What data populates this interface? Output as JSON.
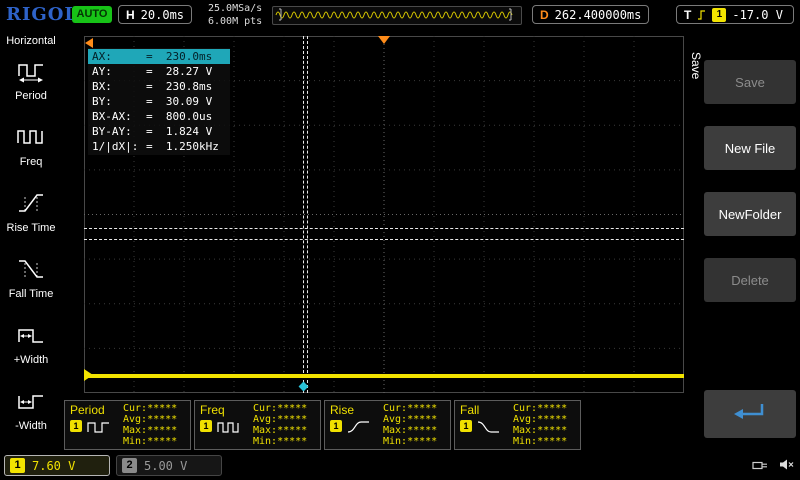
{
  "top_bar": {
    "logo": "RIGOL",
    "status_badge": "AUTO",
    "h_label": "H",
    "timebase": "20.0ms",
    "sample_rate": "25.0MSa/s",
    "memory_depth": "6.00M pts",
    "d_label": "D",
    "delay_value": "262.400000ms",
    "t_label": "T",
    "trigger_channel": "1",
    "trigger_level": "-17.0 V"
  },
  "left_sidebar": {
    "title": "Horizontal",
    "items": [
      {
        "label": "Period",
        "icon": "period-icon"
      },
      {
        "label": "Freq",
        "icon": "freq-icon"
      },
      {
        "label": "Rise Time",
        "icon": "rise-time-icon"
      },
      {
        "label": "Fall Time",
        "icon": "fall-time-icon"
      },
      {
        "label": "+Width",
        "icon": "plus-width-icon"
      },
      {
        "label": "-Width",
        "icon": "minus-width-icon"
      }
    ]
  },
  "cursor_readout": {
    "rows": [
      {
        "label": "AX:",
        "value": "=  230.0ms"
      },
      {
        "label": "AY:",
        "value": "=  28.27 V"
      },
      {
        "label": "BX:",
        "value": "=  230.8ms"
      },
      {
        "label": "BY:",
        "value": "=  30.09 V"
      },
      {
        "label": "BX-AX:",
        "value": "=  800.0us"
      },
      {
        "label": "BY-AY:",
        "value": "=  1.824 V"
      },
      {
        "label": "1/|dX|:",
        "value": "=  1.250kHz"
      }
    ]
  },
  "measurements": [
    {
      "name": "Period",
      "channel": "1",
      "lines": [
        "Cur:*****",
        "Avg:*****",
        "Max:*****",
        "Min:*****"
      ]
    },
    {
      "name": "Freq",
      "channel": "1",
      "lines": [
        "Cur:*****",
        "Avg:*****",
        "Max:*****",
        "Min:*****"
      ]
    },
    {
      "name": "Rise",
      "channel": "1",
      "lines": [
        "Cur:*****",
        "Avg:*****",
        "Max:*****",
        "Min:*****"
      ]
    },
    {
      "name": "Fall",
      "channel": "1",
      "lines": [
        "Cur:*****",
        "Avg:*****",
        "Max:*****",
        "Min:*****"
      ]
    }
  ],
  "right_menu": {
    "tab_label": "Save",
    "buttons": [
      {
        "label": "Save",
        "enabled": false
      },
      {
        "label": "New File",
        "enabled": true
      },
      {
        "label": "NewFolder",
        "enabled": true
      },
      {
        "label": "Delete",
        "enabled": false
      }
    ]
  },
  "bottom_bar": {
    "channels": [
      {
        "id": "1",
        "value": "7.60 V",
        "active": true
      },
      {
        "id": "2",
        "value": "5.00 V",
        "active": false
      }
    ]
  },
  "colors": {
    "channel1_yellow": "#f2e300",
    "trigger_orange": "#ff8c1a",
    "cursor_highlight_teal": "#1fa7b8",
    "auto_green": "#17c317",
    "logo_blue": "#2e63c9",
    "return_arrow_blue": "#3f8fd2"
  }
}
